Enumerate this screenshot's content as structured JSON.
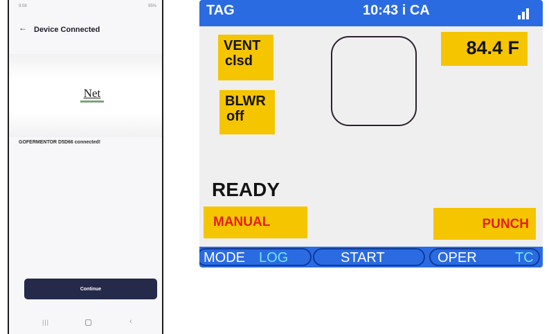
{
  "phone": {
    "status": {
      "time": "9:08",
      "right": "95%"
    },
    "header": {
      "back_icon": "arrow-left-icon",
      "title": "Device Connected"
    },
    "logo": {
      "text": "Net"
    },
    "message": "GOFERMENTOR D5D66 connected!",
    "continue_label": "Continue",
    "nav": {
      "recent_icon": "recent-apps-icon",
      "home_icon": "home-icon",
      "back_icon": "back-chevron-icon"
    }
  },
  "device": {
    "top_bar": {
      "tag": "TAG",
      "clock": "10:43  i CA",
      "signal_icon": "signal-bars-icon"
    },
    "vent": {
      "line1": "VENT",
      "line2": "clsd"
    },
    "blower": {
      "line1": "BLWR",
      "line2": "off"
    },
    "temperature": "84.4 F",
    "status": "READY",
    "softkeys": {
      "left": "MANUAL",
      "right": "PUNCH"
    },
    "bottom_bar": {
      "mode": "MODE",
      "log": "LOG",
      "start": "START",
      "oper": "OPER",
      "tc": "TC"
    },
    "colors": {
      "bar_blue": "#2b6be2",
      "indicator_yellow": "#f5c500",
      "softkey_red": "#e0201b",
      "accent_cyan": "#6fe9f0"
    }
  }
}
